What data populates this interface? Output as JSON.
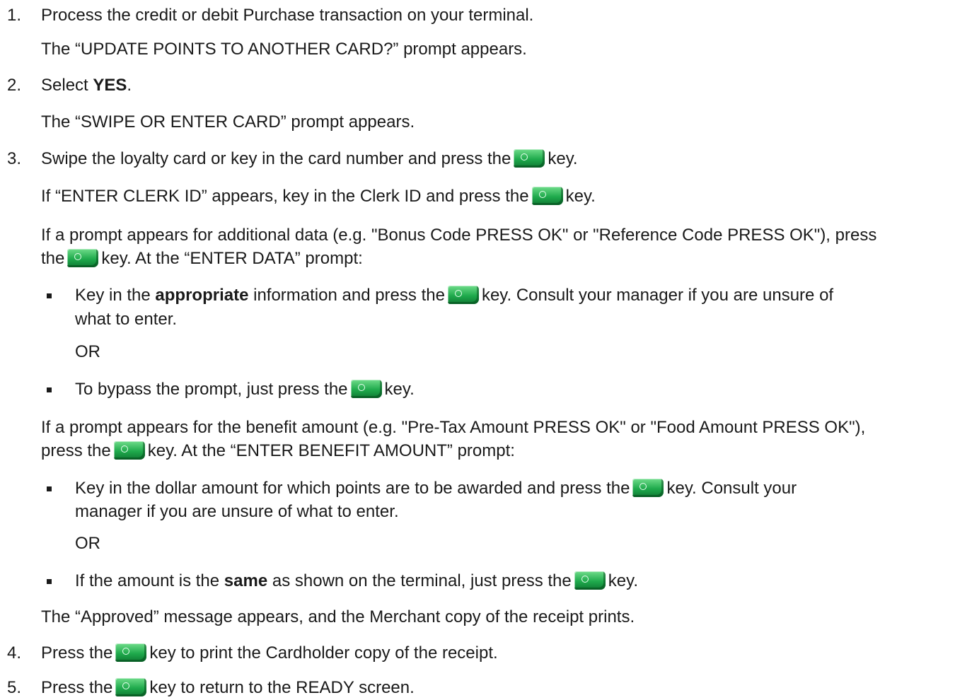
{
  "steps": {
    "s1": {
      "num": "1.",
      "text": "Process the credit or debit Purchase transaction on your terminal."
    },
    "s1_note": "The “UPDATE POINTS TO ANOTHER CARD?” prompt appears.",
    "s2": {
      "num": "2.",
      "pre": "Select ",
      "bold": "YES",
      "post": "."
    },
    "s2_note": "The “SWIPE OR ENTER CARD” prompt appears.",
    "s3": {
      "num": "3.",
      "pre": "Swipe the loyalty card or key in the card number and press the",
      "post": "key."
    },
    "s3_clerk": {
      "pre": "If “ENTER CLERK ID” appears, key in the Clerk ID and press the",
      "post": "key."
    },
    "s3_add1": "If a prompt appears for additional data (e.g. \"Bonus Code PRESS OK\" or \"Reference Code PRESS OK\"), press",
    "s3_add2": {
      "pre": "the",
      "post": "key.  At the “ENTER DATA” prompt:"
    },
    "b1_l1": {
      "pre": "Key in the ",
      "bold": "appropriate",
      "mid": " information and press the",
      "post": "key. Consult your manager if you are unsure of"
    },
    "b1_l2": "what to enter.",
    "or1": "OR",
    "b2": {
      "pre": "To bypass the prompt, just press the",
      "post": "key."
    },
    "ben1": "If a prompt appears for the benefit amount (e.g. \"Pre-Tax Amount PRESS OK\" or \"Food Amount PRESS OK\"),",
    "ben2": {
      "pre": "press the",
      "post": "key. At the “ENTER BENEFIT AMOUNT” prompt:"
    },
    "b3_l1": {
      "pre": "Key in the dollar amount for which points are to be awarded and press the",
      "post": "key. Consult your"
    },
    "b3_l2": "manager if you are unsure of what to enter.",
    "or2": "OR",
    "b4": {
      "pre": "If the amount is the ",
      "bold": "same",
      "mid": " as shown on the terminal, just press the",
      "post": "key."
    },
    "approved": "The “Approved” message appears, and the Merchant copy of the receipt prints.",
    "s4": {
      "num": "4.",
      "pre": "Press the",
      "post": "key to print the Cardholder copy of the receipt."
    },
    "s5": {
      "num": "5.",
      "pre": "Press the",
      "post": "key to return to the READY screen."
    }
  },
  "icons": {
    "ok_key": "green-ok-key-icon"
  },
  "colors": {
    "ok_key": "#1faa4c",
    "text": "#1a1a1a"
  }
}
